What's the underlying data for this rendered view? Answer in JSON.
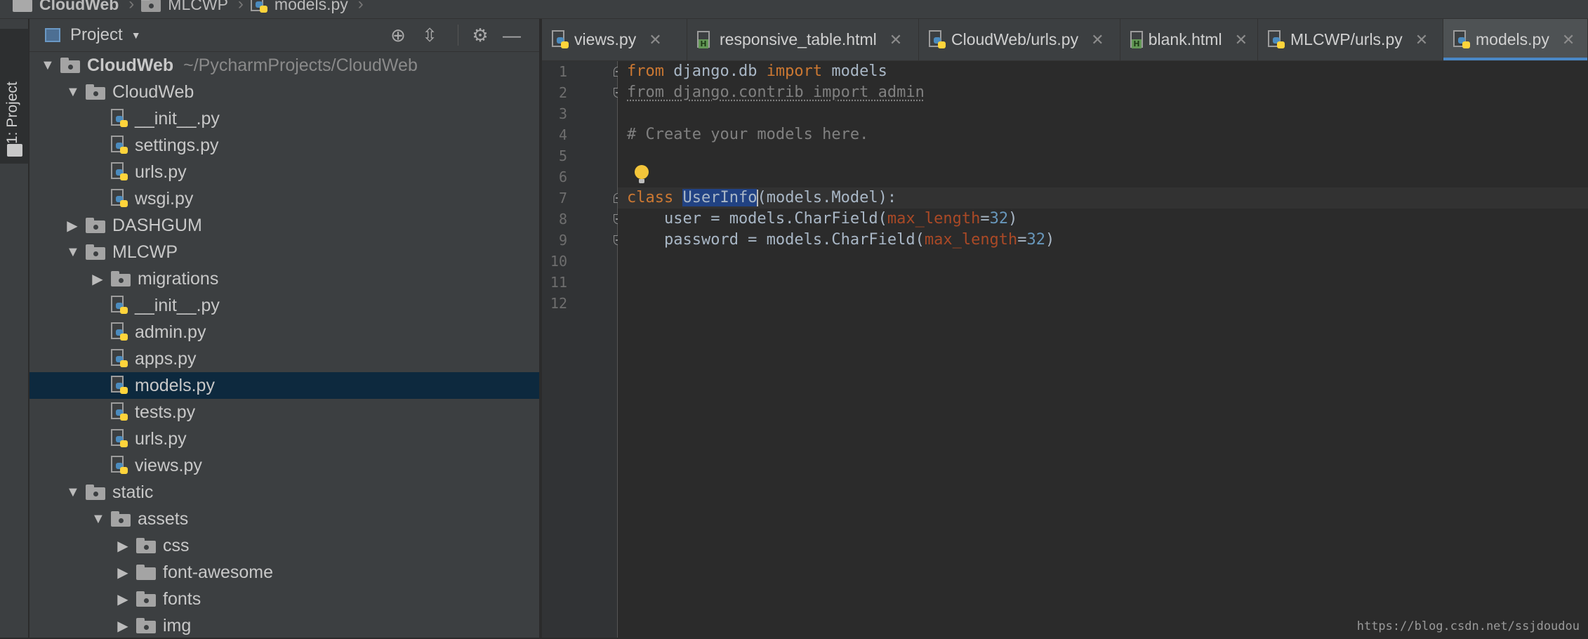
{
  "breadcrumb": {
    "items": [
      {
        "label": "CloudWeb",
        "icon": "folder-icon"
      },
      {
        "label": "MLCWP",
        "icon": "package-folder-icon"
      },
      {
        "label": "models.py",
        "icon": "python-file-icon"
      }
    ]
  },
  "tool_stripe": {
    "project_tab_label": "1: Project"
  },
  "project_panel": {
    "title": "Project",
    "buttons": [
      "locate-icon",
      "collapse-all-icon",
      "gear-icon",
      "minimize-icon"
    ],
    "tree": [
      {
        "label": "CloudWeb",
        "path": "~/PycharmProjects/CloudWeb",
        "type": "root",
        "level": 0,
        "expanded": true
      },
      {
        "label": "CloudWeb",
        "type": "package",
        "level": 1,
        "expanded": true
      },
      {
        "label": "__init__.py",
        "type": "py",
        "level": 2
      },
      {
        "label": "settings.py",
        "type": "py",
        "level": 2
      },
      {
        "label": "urls.py",
        "type": "py",
        "level": 2
      },
      {
        "label": "wsgi.py",
        "type": "py",
        "level": 2
      },
      {
        "label": "DASHGUM",
        "type": "package",
        "level": 1,
        "expanded": false
      },
      {
        "label": "MLCWP",
        "type": "package",
        "level": 1,
        "expanded": true
      },
      {
        "label": "migrations",
        "type": "package",
        "level": 2,
        "expanded": false
      },
      {
        "label": "__init__.py",
        "type": "py",
        "level": 2
      },
      {
        "label": "admin.py",
        "type": "py",
        "level": 2
      },
      {
        "label": "apps.py",
        "type": "py",
        "level": 2
      },
      {
        "label": "models.py",
        "type": "py",
        "level": 2,
        "selected": true
      },
      {
        "label": "tests.py",
        "type": "py",
        "level": 2
      },
      {
        "label": "urls.py",
        "type": "py",
        "level": 2
      },
      {
        "label": "views.py",
        "type": "py",
        "level": 2
      },
      {
        "label": "static",
        "type": "package",
        "level": 1,
        "expanded": true
      },
      {
        "label": "assets",
        "type": "package",
        "level": 2,
        "expanded": true
      },
      {
        "label": "css",
        "type": "package",
        "level": 3,
        "expanded": false
      },
      {
        "label": "font-awesome",
        "type": "folder",
        "level": 3,
        "expanded": false
      },
      {
        "label": "fonts",
        "type": "package",
        "level": 3,
        "expanded": false
      },
      {
        "label": "img",
        "type": "package",
        "level": 3,
        "expanded": false
      }
    ]
  },
  "tabs": [
    {
      "label": "views.py",
      "icon": "python-file-icon",
      "active": false
    },
    {
      "label": "responsive_table.html",
      "icon": "html-file-icon",
      "active": false
    },
    {
      "label": "CloudWeb/urls.py",
      "icon": "python-file-icon",
      "active": false
    },
    {
      "label": "blank.html",
      "icon": "html-file-icon",
      "active": false
    },
    {
      "label": "MLCWP/urls.py",
      "icon": "python-file-icon",
      "active": false
    },
    {
      "label": "models.py",
      "icon": "python-file-icon",
      "active": true
    }
  ],
  "editor": {
    "line_numbers": [
      "1",
      "2",
      "3",
      "4",
      "5",
      "6",
      "7",
      "8",
      "9",
      "10",
      "11",
      "12"
    ],
    "lines": [
      [
        {
          "t": "from",
          "c": "kw"
        },
        {
          "t": " django.db ",
          "c": ""
        },
        {
          "t": "import",
          "c": "kw"
        },
        {
          "t": " models",
          "c": ""
        }
      ],
      [
        {
          "t": "from django.contrib import admin",
          "c": "unused"
        }
      ],
      [],
      [
        {
          "t": "# Create your models here.",
          "c": "cm"
        }
      ],
      [],
      [],
      [
        {
          "t": "class",
          "c": "kw"
        },
        {
          "t": " ",
          "c": ""
        },
        {
          "t": "UserInfo",
          "c": "sel"
        },
        {
          "t": "|",
          "c": "caret"
        },
        {
          "t": "(models.Model):",
          "c": ""
        }
      ],
      [
        {
          "t": "    user = models.CharField(",
          "c": ""
        },
        {
          "t": "max_length",
          "c": "prm"
        },
        {
          "t": "=",
          "c": ""
        },
        {
          "t": "32",
          "c": "num"
        },
        {
          "t": ")",
          "c": ""
        }
      ],
      [
        {
          "t": "    password = models.CharField(",
          "c": ""
        },
        {
          "t": "max_length",
          "c": "prm"
        },
        {
          "t": "=",
          "c": ""
        },
        {
          "t": "32",
          "c": "num"
        },
        {
          "t": ")",
          "c": ""
        }
      ],
      [],
      [],
      []
    ],
    "current_line": 7,
    "watermark": "https://blog.csdn.net/ssjdoudou"
  },
  "colors": {
    "background": "#2b2b2b",
    "panel": "#3c3f41",
    "selection": "#0d293e",
    "keyword": "#cc7832",
    "number": "#6897bb",
    "param": "#aa4926",
    "accent": "#4a88c7"
  }
}
